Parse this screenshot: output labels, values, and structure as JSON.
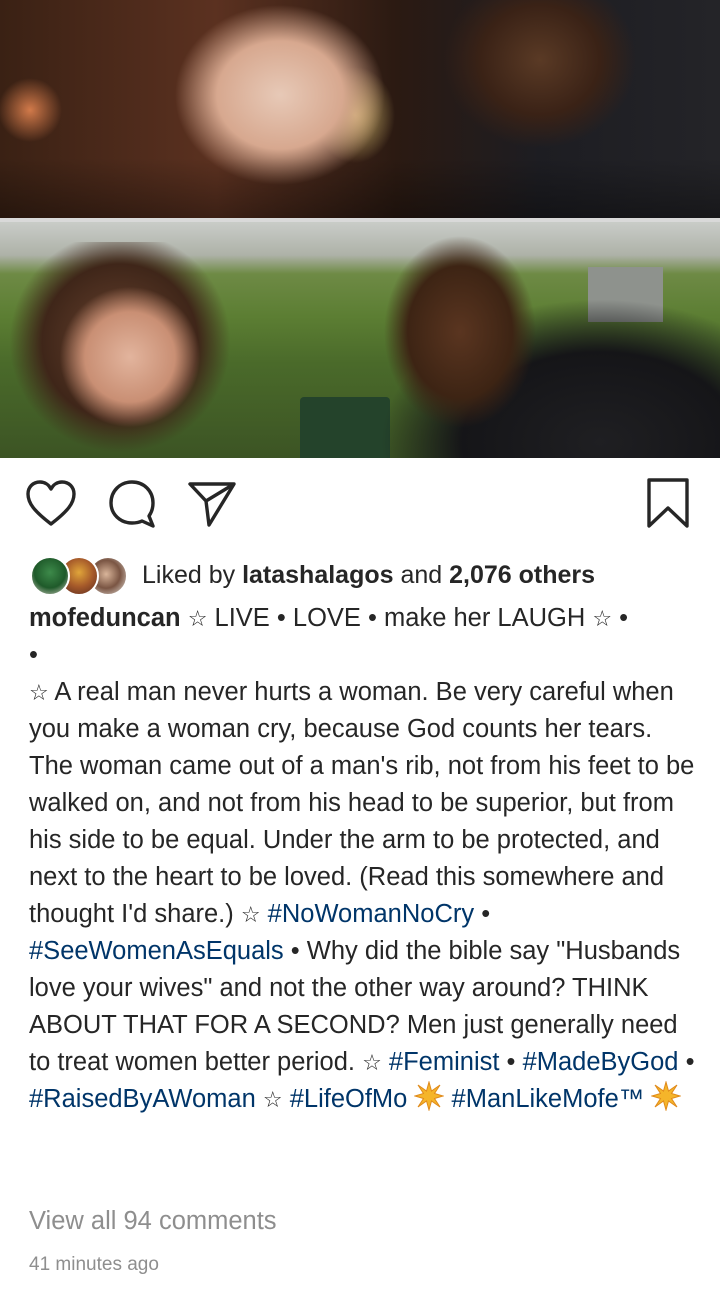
{
  "post": {
    "photo_alt": "",
    "actions": {
      "like_icon": "heart-icon",
      "comment_icon": "comment-icon",
      "share_icon": "send-icon",
      "save_icon": "bookmark-icon"
    },
    "likes": {
      "prefix": "Liked by ",
      "user": "latashalagos",
      "middle": " and ",
      "count": "2,076 others"
    },
    "caption": {
      "username": "mofeduncan",
      "star": "☆",
      "line1_text": " LIVE • LOVE • make her LAUGH ",
      "line1_end": " •",
      "bullet_line": "•",
      "para1": " A real man never hurts a woman. Be very careful when you make a woman cry, because God counts her tears. The woman came out of a man's rib, not from his feet to be walked on, and not from his head to be superior, but from his side to be equal. Under the arm to be protected, and next to the heart to be loved. (Read this somewhere and thought I'd share.)",
      "tag1": "#NoWomanNoCry",
      "sep1": " • ",
      "tag2": "#SeeWomenAsEquals",
      "para2": " • Why did the bible say \"Husbands love your wives\" and not the other way around? THINK ABOUT THAT FOR A SECOND? Men just generally need to treat women better period. ",
      "tag3": "#Feminist",
      "sep2": " • ",
      "tag4": "#MadeByGod",
      "sep3": " •",
      "tag5": "#RaisedByAWoman",
      "tag6": "#LifeOfMo",
      "tag7": "#ManLikeMofe™"
    },
    "view_comments": "View all 94 comments",
    "timestamp": "41 minutes ago"
  },
  "colors": {
    "text": "#262626",
    "hashtag": "#003569",
    "muted": "#8e8e8e",
    "burst": "#f5b52a"
  }
}
